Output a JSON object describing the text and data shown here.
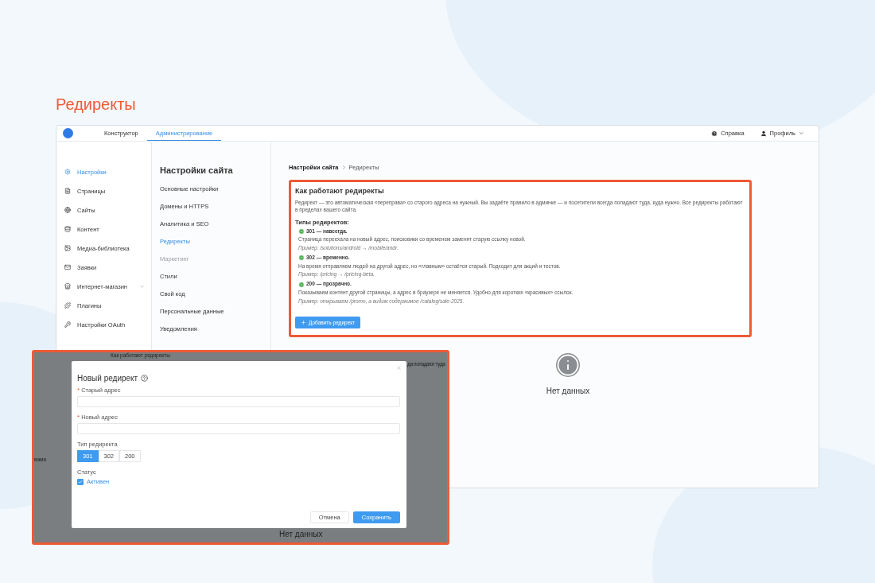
{
  "page_title": "Редиректы",
  "topbar": {
    "tabs": [
      {
        "label": "Конструктор",
        "selected": false
      },
      {
        "label": "Администрирование",
        "selected": true
      }
    ],
    "help": "Справка",
    "profile": "Профиль"
  },
  "sidebar": {
    "items": [
      {
        "label": "Настройки",
        "selected": true,
        "expandable": false
      },
      {
        "label": "Страницы",
        "selected": false,
        "expandable": false
      },
      {
        "label": "Сайты",
        "selected": false,
        "expandable": false
      },
      {
        "label": "Контент",
        "selected": false,
        "expandable": false
      },
      {
        "label": "Медиа-библиотека",
        "selected": false,
        "expandable": false
      },
      {
        "label": "Заявки",
        "selected": false,
        "expandable": false
      },
      {
        "label": "Интернет-магазин",
        "selected": false,
        "expandable": true
      },
      {
        "label": "Плагины",
        "selected": false,
        "expandable": false
      },
      {
        "label": "Настройки OAuth",
        "selected": false,
        "expandable": false
      }
    ]
  },
  "submenu": {
    "title": "Настройки сайта",
    "items": [
      {
        "label": "Основные настройки",
        "selected": false,
        "disabled": false
      },
      {
        "label": "Домены и HTTPS",
        "selected": false,
        "disabled": false
      },
      {
        "label": "Аналитика и SEO",
        "selected": false,
        "disabled": false
      },
      {
        "label": "Редиректы",
        "selected": true,
        "disabled": false
      },
      {
        "label": "Маркетинг",
        "selected": false,
        "disabled": true
      },
      {
        "label": "Стили",
        "selected": false,
        "disabled": false
      },
      {
        "label": "Свой код",
        "selected": false,
        "disabled": false
      },
      {
        "label": "Персональные данные",
        "selected": false,
        "disabled": false
      },
      {
        "label": "Уведомления",
        "selected": false,
        "disabled": false
      }
    ]
  },
  "breadcrumb": [
    "Настройки сайта",
    "Редиректы"
  ],
  "info_card": {
    "title": "Как работают редиректы",
    "intro": "Редирект — это автоматическая «переправа» со старого адреса на нужный. Вы задаёте правило в админке — и посетители всегда попадают туда, куда нужно. Все редиректы работают в пределах вашего сайта.",
    "types_heading": "Типы редиректов:",
    "types": [
      {
        "title": "301 — навсегда.",
        "description": "Страница переехала на новый адрес, поисковики со временем заменят старую ссылку новой.",
        "example": "Пример: /solutions/android → /mobile/andr."
      },
      {
        "title": "302 — временно.",
        "description": "На время отправляем людей на другой адрес, но «главным» остаётся старый. Подходит для акций и тестов.",
        "example": "Пример: /pricing → /pricing-beta."
      },
      {
        "title": "200 — прозрачно.",
        "description": "Показываем контент другой страницы, а адрес в браузере не меняется. Удобно для коротких «красивых» ссылок.",
        "example": "Пример: открываем /promo, а видим содержимое /catalog/sale-2025."
      }
    ],
    "add_button": "Добавить редирект"
  },
  "empty_state": {
    "text": "Нет данных"
  },
  "modal_overlay": {
    "backdrop_texts": [
      "Как работают редиректы",
      "да попадают туда",
      "вами",
      "Нет данных"
    ],
    "dialog": {
      "title": "Новый редирект",
      "fields": [
        {
          "mark": "*",
          "label": "Старый адрес"
        },
        {
          "mark": "*",
          "label": "Новый адрес"
        }
      ],
      "type_label": "Тип редиректа",
      "types": [
        {
          "label": "301",
          "selected": true
        },
        {
          "label": "302",
          "selected": false
        },
        {
          "label": "200",
          "selected": false
        }
      ],
      "status_label": "Статус",
      "active": {
        "label": "Активен",
        "checked": true
      },
      "cancel": "Отмена",
      "save": "Сохранить"
    }
  }
}
